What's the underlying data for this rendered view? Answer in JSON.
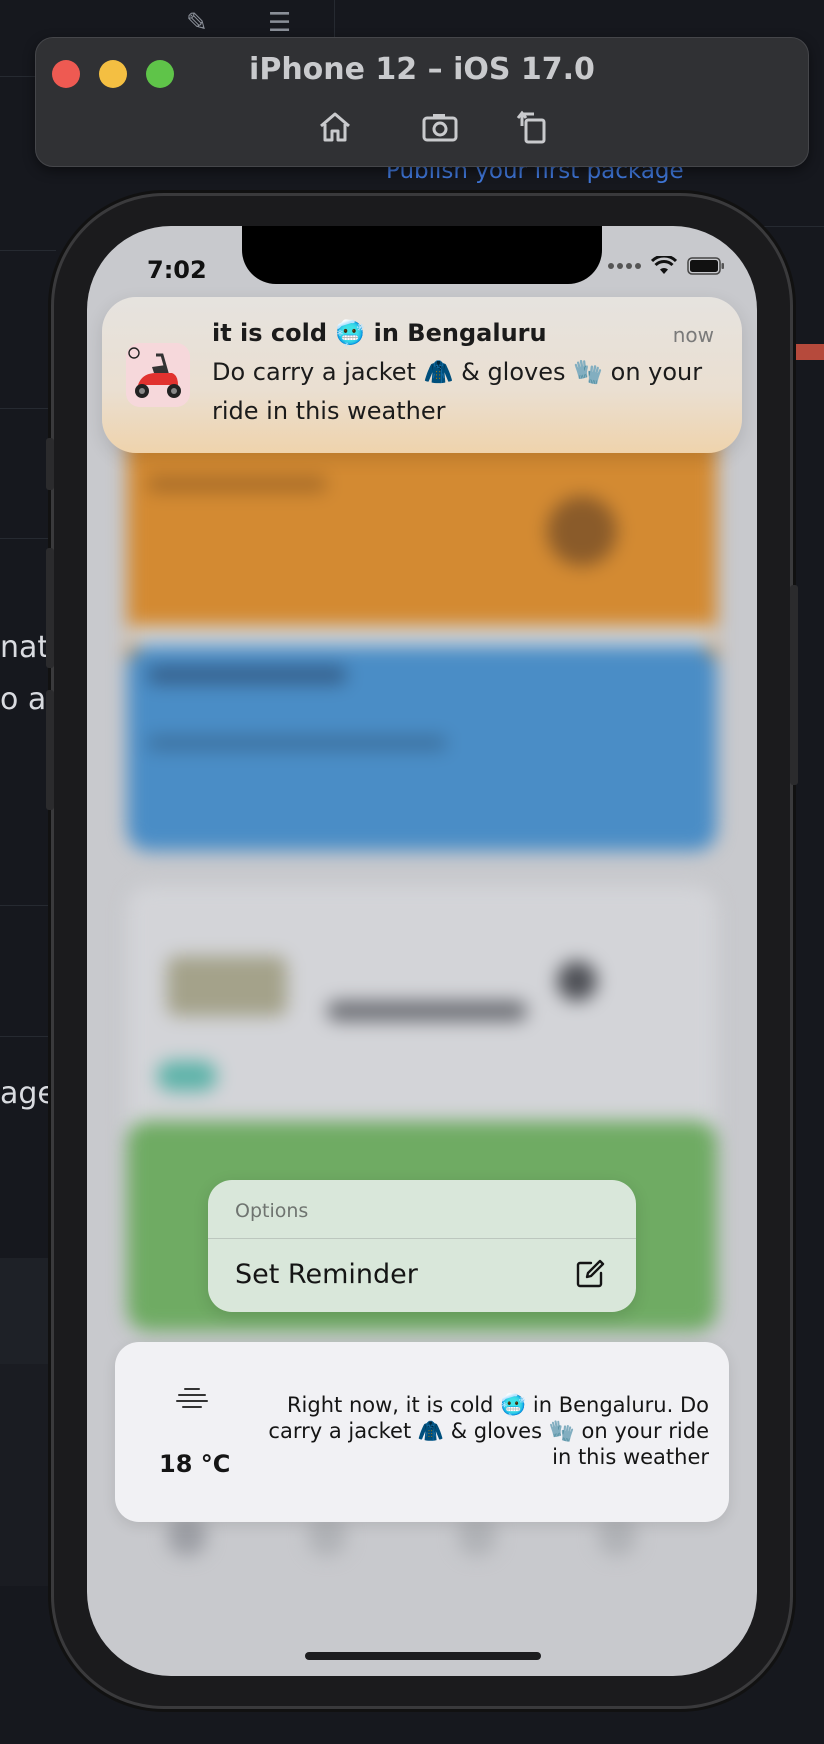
{
  "background": {
    "link_text": "Publish your first package",
    "left_fragments": [
      "natio",
      "o a",
      "ager"
    ],
    "top_icons": [
      "edit-pencil-icon",
      "list-icon"
    ]
  },
  "simulator": {
    "title": "iPhone 12 – iOS 17.0",
    "buttons": [
      "home-icon",
      "screenshot-icon",
      "rotate-icon"
    ]
  },
  "status_bar": {
    "time": "7:02"
  },
  "notification": {
    "title": "it is cold 🥶 in Bengaluru",
    "time": "now",
    "body": "Do carry a jacket 🧥 & gloves 🧤 on your ride in this weather",
    "app_icon": "scooter-app-icon"
  },
  "options_menu": {
    "header": "Options",
    "items": [
      {
        "label": "Set Reminder",
        "icon": "compose-icon"
      }
    ]
  },
  "weather_widget": {
    "icon": "fog-icon",
    "temperature": "18 °C",
    "message": "Right now, it is cold 🥶 in Bengaluru. Do carry a jacket 🧥 & gloves 🧤 on your ride in this weather"
  }
}
